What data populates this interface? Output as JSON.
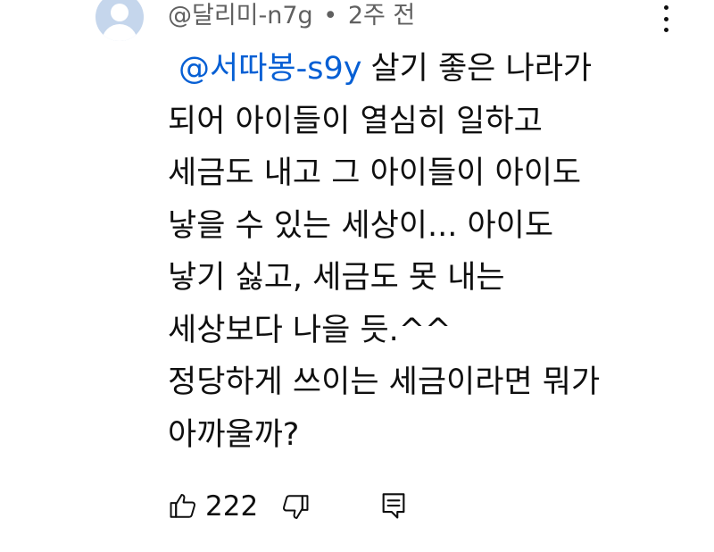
{
  "comment": {
    "author": "@달리미-n7g",
    "separator": "•",
    "time": "2주 전",
    "mention": "@서따봉-s9y",
    "lines": [
      "살기 좋은 나라가",
      "되어 아이들이 열심히 일하고",
      "세금도 내고 그 아이들이 아이도",
      "낳을 수 있는 세상이... 아이도",
      "낳기 싫고, 세금도 못 내는",
      "세상보다 나을 듯.^^",
      "정당하게 쓰이는 세금이라면 뭐가",
      "아까울까?"
    ],
    "like_count": "222"
  },
  "colors": {
    "mention": "#065fd4",
    "meta_text": "#606060",
    "body_text": "#0f0f0f",
    "avatar_bg": "#c5d6ec"
  },
  "icons": {
    "avatar": "default-avatar-icon",
    "menu": "more-vertical-icon",
    "like": "thumb-up-icon",
    "dislike": "thumb-down-icon",
    "reply": "reply-comment-icon"
  }
}
